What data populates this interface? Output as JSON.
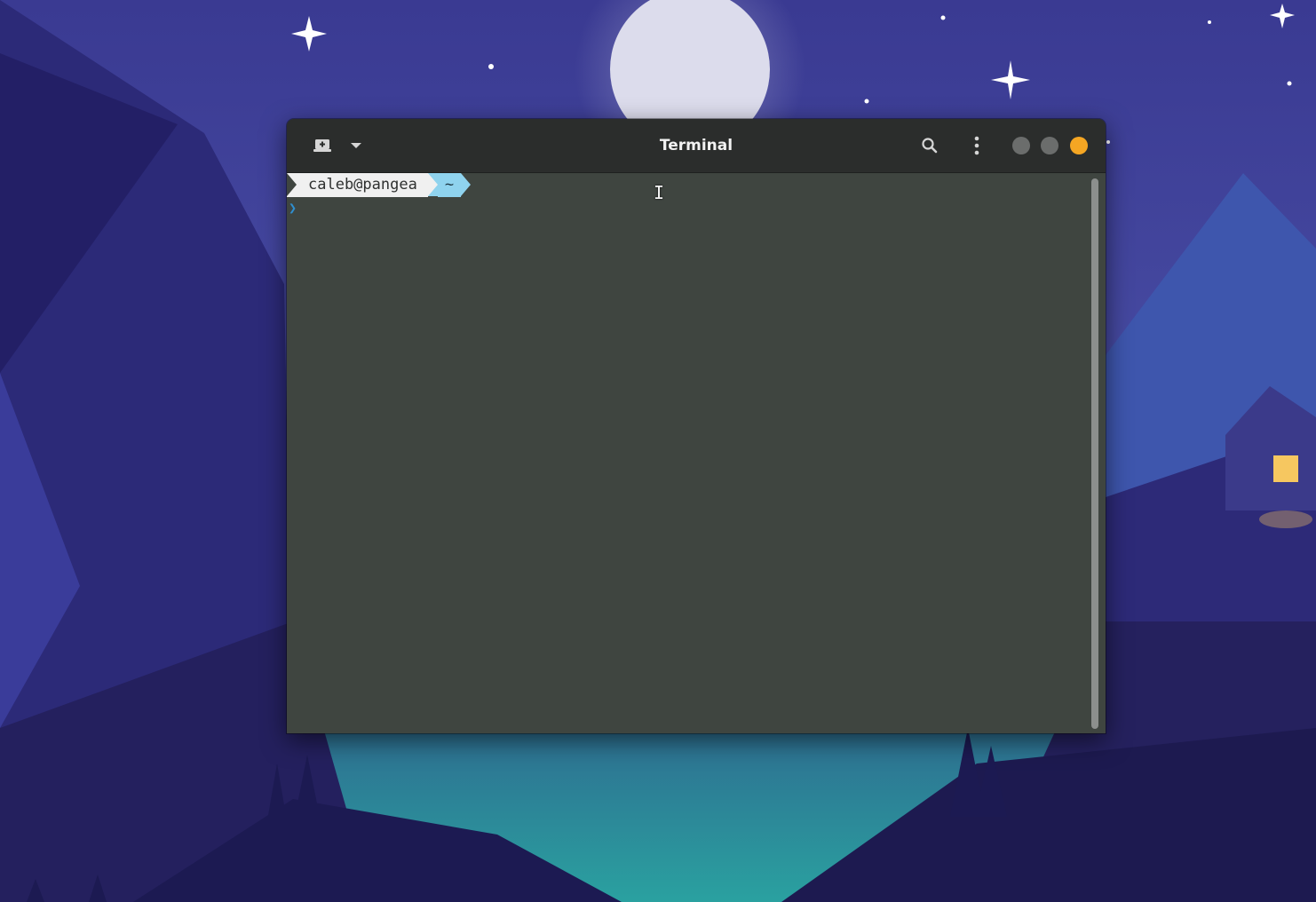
{
  "window": {
    "title": "Terminal",
    "controls": {
      "minimize_color": "#6b6d6c",
      "maximize_color": "#6b6d6c",
      "close_color": "#f5a623"
    }
  },
  "headerbar": {
    "new_tab_icon": "new-terminal-tab-icon",
    "tab_menu_icon": "chevron-down-icon",
    "search_icon": "search-icon",
    "menu_icon": "vertical-dots-icon"
  },
  "terminal": {
    "prompt_user": "caleb@pangea",
    "prompt_dir": "~",
    "prompt_char": "❯",
    "background": "#3f4540"
  },
  "colors": {
    "user_segment": "#f0f0f0",
    "dir_segment": "#8fd3ee",
    "prompt_char": "#2f8fd0",
    "accent": "#f5a623"
  }
}
